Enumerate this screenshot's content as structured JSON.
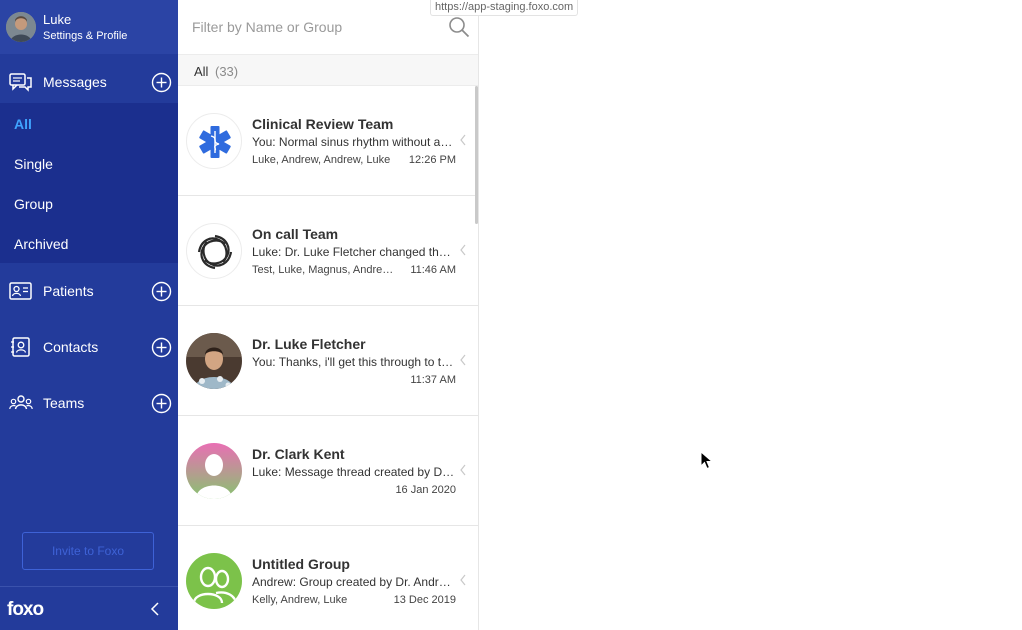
{
  "profile": {
    "name": "Luke",
    "subtitle": "Settings & Profile"
  },
  "nav": {
    "messages": {
      "label": "Messages",
      "icon": "chat-bubbles-icon"
    },
    "submenu": [
      {
        "label": "All",
        "active": true
      },
      {
        "label": "Single",
        "active": false
      },
      {
        "label": "Group",
        "active": false
      },
      {
        "label": "Archived",
        "active": false
      }
    ],
    "patients": {
      "label": "Patients",
      "icon": "id-card-icon"
    },
    "contacts": {
      "label": "Contacts",
      "icon": "address-book-icon"
    },
    "teams": {
      "label": "Teams",
      "icon": "people-group-icon"
    }
  },
  "invite": {
    "label": "Invite to Foxo"
  },
  "logo": {
    "text": "foxo"
  },
  "search": {
    "placeholder": "Filter by Name or Group",
    "value": ""
  },
  "browser": {
    "url": "https://app-staging.foxo.com"
  },
  "filter": {
    "label": "All",
    "count": "(33)"
  },
  "threads": [
    {
      "title": "Clinical Review Team",
      "preview": "You: Normal sinus rhythm without any ectopic beats",
      "members": "Luke, Andrew, Andrew, Luke",
      "time": "12:26 PM",
      "avatar": "medical-star-icon"
    },
    {
      "title": "On call Team",
      "preview": "Luke: Dr. Luke Fletcher changed the group name",
      "members": "Test, Luke, Magnus, Andrew, Kelly",
      "time": "11:46 AM",
      "avatar": "swirl-logo-icon"
    },
    {
      "title": "Dr. Luke Fletcher",
      "preview": "You: Thanks, i'll get this through to the team",
      "members": "",
      "time": "11:37 AM",
      "avatar": "photo-avatar"
    },
    {
      "title": "Dr. Clark Kent",
      "preview": "Luke: Message thread created by Dr. Luke Fletcher",
      "members": "",
      "time": "16 Jan 2020",
      "avatar": "person-silhouette-icon"
    },
    {
      "title": "Untitled Group",
      "preview": "Andrew: Group created by Dr. Andrew Smith",
      "members": "Kelly, Andrew, Luke",
      "time": "13 Dec 2019",
      "avatar": "group-silhouette-icon"
    }
  ],
  "colors": {
    "sidebar": "#233b9b",
    "submenu": "#1b2f8e",
    "accent": "#3fa3ff",
    "invite_border": "#3e62d6"
  }
}
